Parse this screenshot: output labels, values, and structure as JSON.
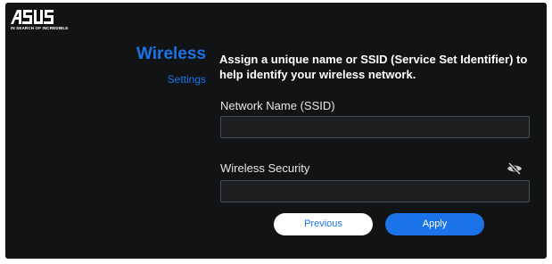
{
  "brand": {
    "logo_text": "ASUS",
    "tagline": "IN SEARCH OF INCREDIBLE"
  },
  "sidebar": {
    "title": "Wireless",
    "subtitle": "Settings"
  },
  "main": {
    "heading": "Assign a unique name or SSID (Service Set Identifier) to help identify your wireless network.",
    "ssid": {
      "label": "Network Name (SSID)",
      "value": ""
    },
    "security": {
      "label": "Wireless Security",
      "value": "",
      "visibility_icon": "eye-slash-icon"
    }
  },
  "buttons": {
    "previous": "Previous",
    "apply": "Apply"
  },
  "colors": {
    "background": "#111315",
    "accent": "#1a73e8",
    "text": "#ffffff"
  }
}
